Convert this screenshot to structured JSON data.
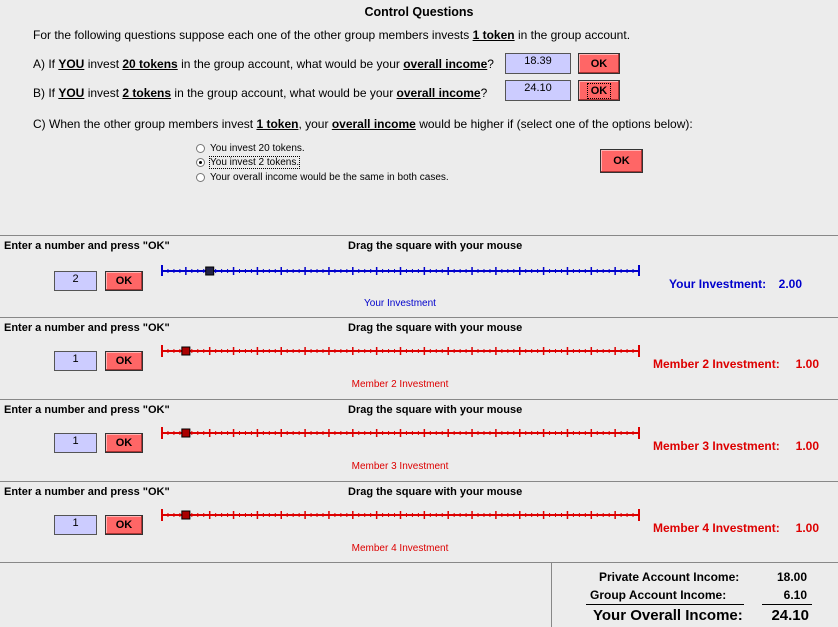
{
  "control_questions": {
    "title": "Control Questions",
    "intro_pre": "For the following questions suppose each one of the other group members invests ",
    "intro_token": "1 token",
    "intro_post": " in the group account.",
    "qa": {
      "pre": "A) If ",
      "you": "YOU",
      "mid": " invest ",
      "tokens": "20 tokens",
      "mid2": " in the group account, what would be your ",
      "income": "overall income",
      "end": "?",
      "answer": "18.39",
      "ok": "OK"
    },
    "qb": {
      "pre": "B) If ",
      "you": "YOU",
      "mid": " invest ",
      "tokens": "2 tokens",
      "mid2": " in the group account, what would be your ",
      "income": "overall income",
      "end": "?",
      "answer": "24.10",
      "ok": "OK"
    },
    "qc": {
      "pre": "C) When the other group members invest ",
      "token": "1 token",
      "mid": ", your ",
      "income": "overall income",
      "post": " would be higher if (select one of the options below):",
      "options": [
        "You invest 20 tokens.",
        "You invest 2 tokens.",
        "Your overall income would be the same in both cases."
      ],
      "selected": 1,
      "ok": "OK"
    }
  },
  "panel_common": {
    "enter_label": "Enter a number and press \"OK\"",
    "drag_label": "Drag the square with your mouse",
    "ok": "OK",
    "ticks": [
      "0",
      "1",
      "2",
      "3",
      "4",
      "5",
      "6",
      "7",
      "8",
      "9",
      "10",
      "11",
      "12",
      "13",
      "14",
      "15",
      "16",
      "17",
      "18",
      "19",
      "20"
    ]
  },
  "panels": [
    {
      "input": "2",
      "slider_value": 2,
      "caption": "Your Investment",
      "label": "Your Investment:",
      "value": "2.00",
      "color": "#0000cc"
    },
    {
      "input": "1",
      "slider_value": 1,
      "caption": "Member 2 Investment",
      "label": "Member 2 Investment:",
      "value": "1.00",
      "color": "#dd0000"
    },
    {
      "input": "1",
      "slider_value": 1,
      "caption": "Member 3 Investment",
      "label": "Member 3 Investment:",
      "value": "1.00",
      "color": "#dd0000"
    },
    {
      "input": "1",
      "slider_value": 1,
      "caption": "Member 4 Investment",
      "label": "Member 4 Investment:",
      "value": "1.00",
      "color": "#dd0000"
    }
  ],
  "summary": {
    "private_label": "Private Account Income:",
    "private_value": "18.00",
    "group_label": "Group Account Income:",
    "group_value": "6.10",
    "overall_label": "Your Overall Income:",
    "overall_value": "24.10"
  },
  "colors": {
    "ok_button": "#ff6666",
    "value_box": "#ccccff",
    "blue": "#0000cc",
    "red": "#dd0000"
  }
}
